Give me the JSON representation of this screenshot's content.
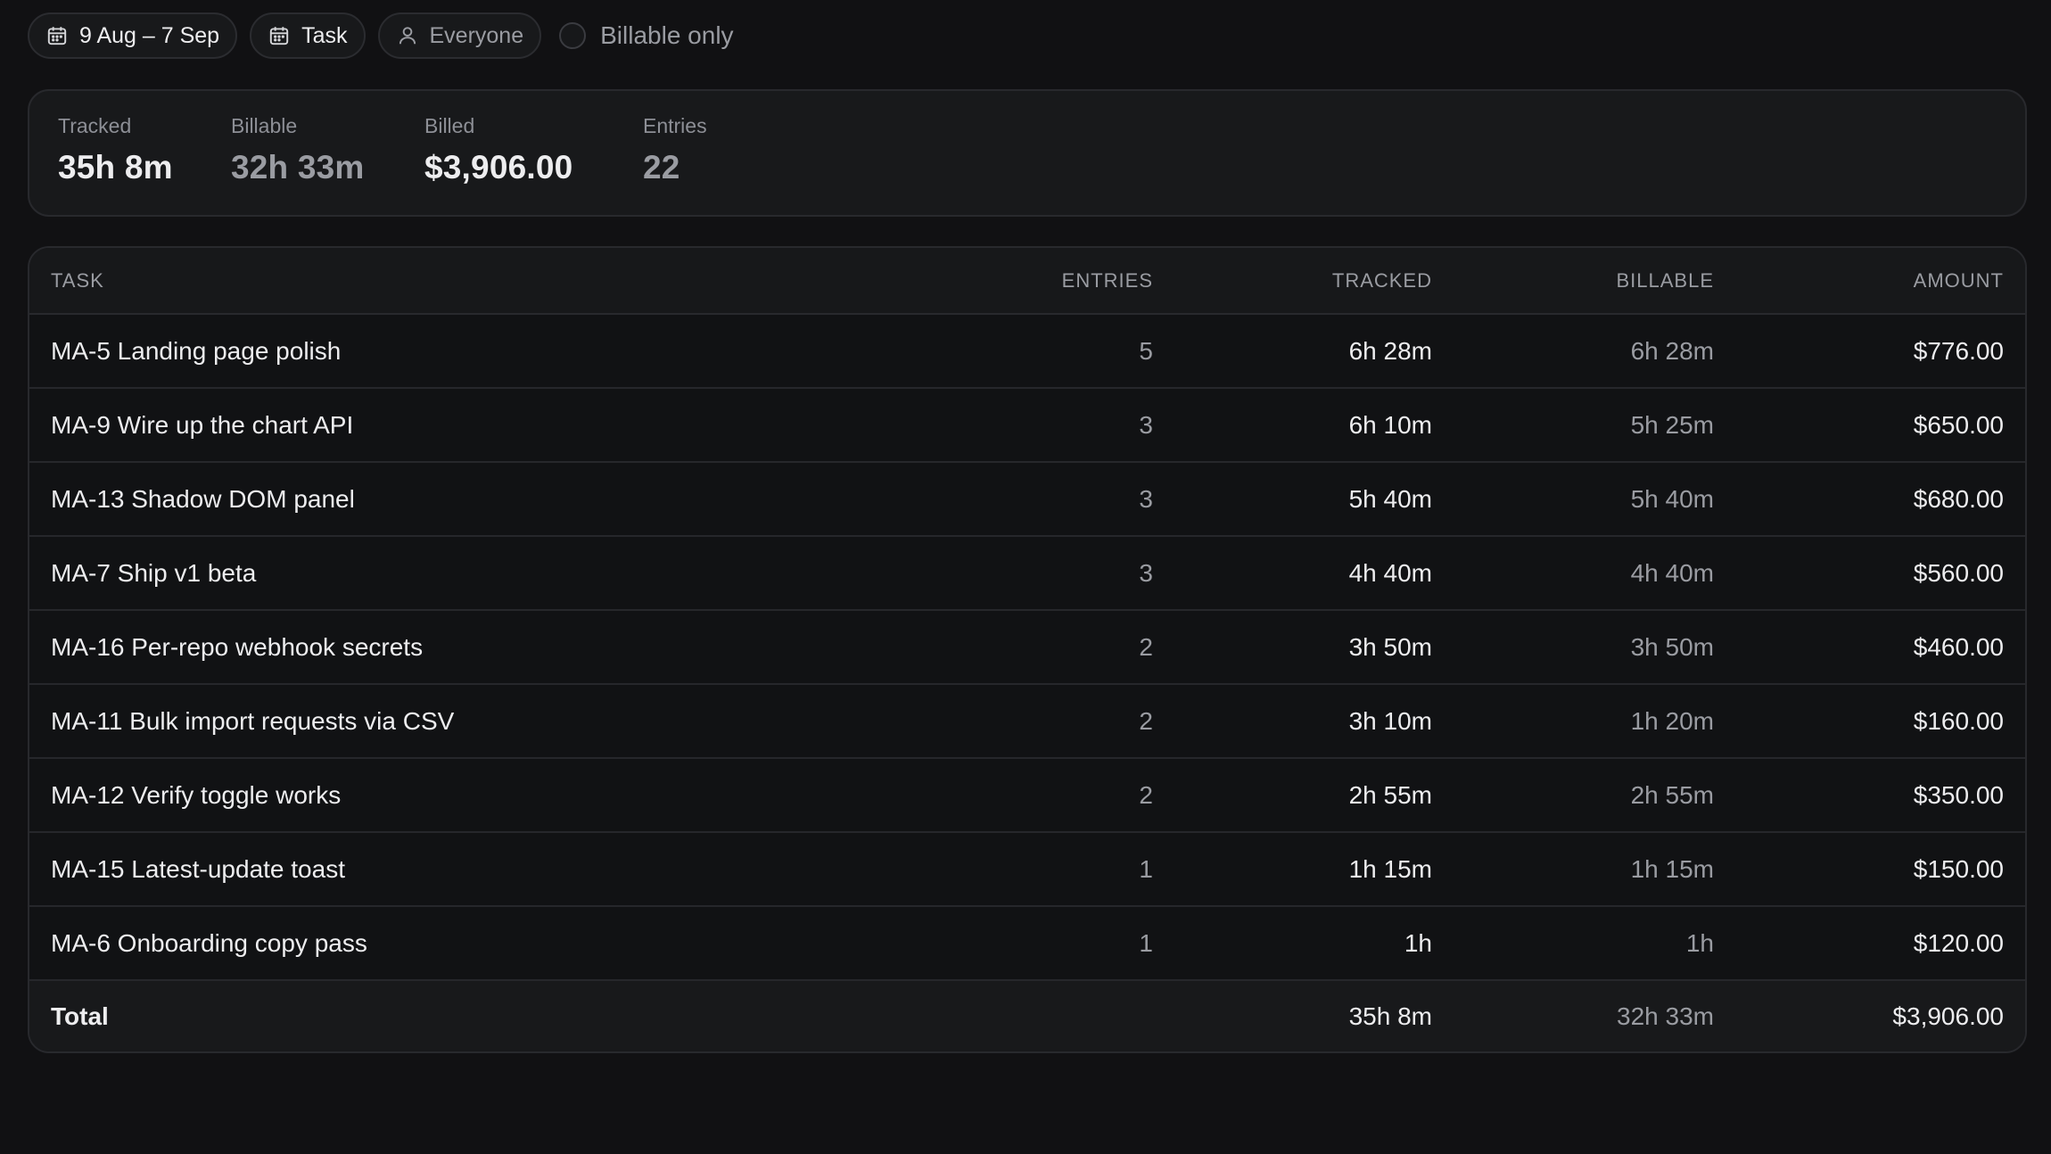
{
  "filters": {
    "date_range": "9 Aug – 7 Sep",
    "group_by": "Task",
    "people": "Everyone",
    "billable_only_label": "Billable only",
    "billable_only_checked": false
  },
  "stats": {
    "tracked_label": "Tracked",
    "tracked_value": "35h 8m",
    "billable_label": "Billable",
    "billable_value": "32h 33m",
    "billed_label": "Billed",
    "billed_value": "$3,906.00",
    "entries_label": "Entries",
    "entries_value": "22"
  },
  "table": {
    "headers": {
      "task": "TASK",
      "entries": "ENTRIES",
      "tracked": "TRACKED",
      "billable": "BILLABLE",
      "amount": "AMOUNT"
    },
    "rows": [
      {
        "task": "MA-5 Landing page polish",
        "entries": "5",
        "tracked": "6h 28m",
        "billable": "6h 28m",
        "amount": "$776.00"
      },
      {
        "task": "MA-9 Wire up the chart API",
        "entries": "3",
        "tracked": "6h 10m",
        "billable": "5h 25m",
        "amount": "$650.00"
      },
      {
        "task": "MA-13 Shadow DOM panel",
        "entries": "3",
        "tracked": "5h 40m",
        "billable": "5h 40m",
        "amount": "$680.00"
      },
      {
        "task": "MA-7 Ship v1 beta",
        "entries": "3",
        "tracked": "4h 40m",
        "billable": "4h 40m",
        "amount": "$560.00"
      },
      {
        "task": "MA-16 Per-repo webhook secrets",
        "entries": "2",
        "tracked": "3h 50m",
        "billable": "3h 50m",
        "amount": "$460.00"
      },
      {
        "task": "MA-11 Bulk import requests via CSV",
        "entries": "2",
        "tracked": "3h 10m",
        "billable": "1h 20m",
        "amount": "$160.00"
      },
      {
        "task": "MA-12 Verify toggle works",
        "entries": "2",
        "tracked": "2h 55m",
        "billable": "2h 55m",
        "amount": "$350.00"
      },
      {
        "task": "MA-15 Latest-update toast",
        "entries": "1",
        "tracked": "1h 15m",
        "billable": "1h 15m",
        "amount": "$150.00"
      },
      {
        "task": "MA-6 Onboarding copy pass",
        "entries": "1",
        "tracked": "1h",
        "billable": "1h",
        "amount": "$120.00"
      }
    ],
    "total": {
      "label": "Total",
      "entries": "",
      "tracked": "35h 8m",
      "billable": "32h 33m",
      "amount": "$3,906.00"
    }
  },
  "icons": {
    "date_range": "calendar-icon",
    "group_by": "calendar-icon",
    "people": "user-icon"
  }
}
